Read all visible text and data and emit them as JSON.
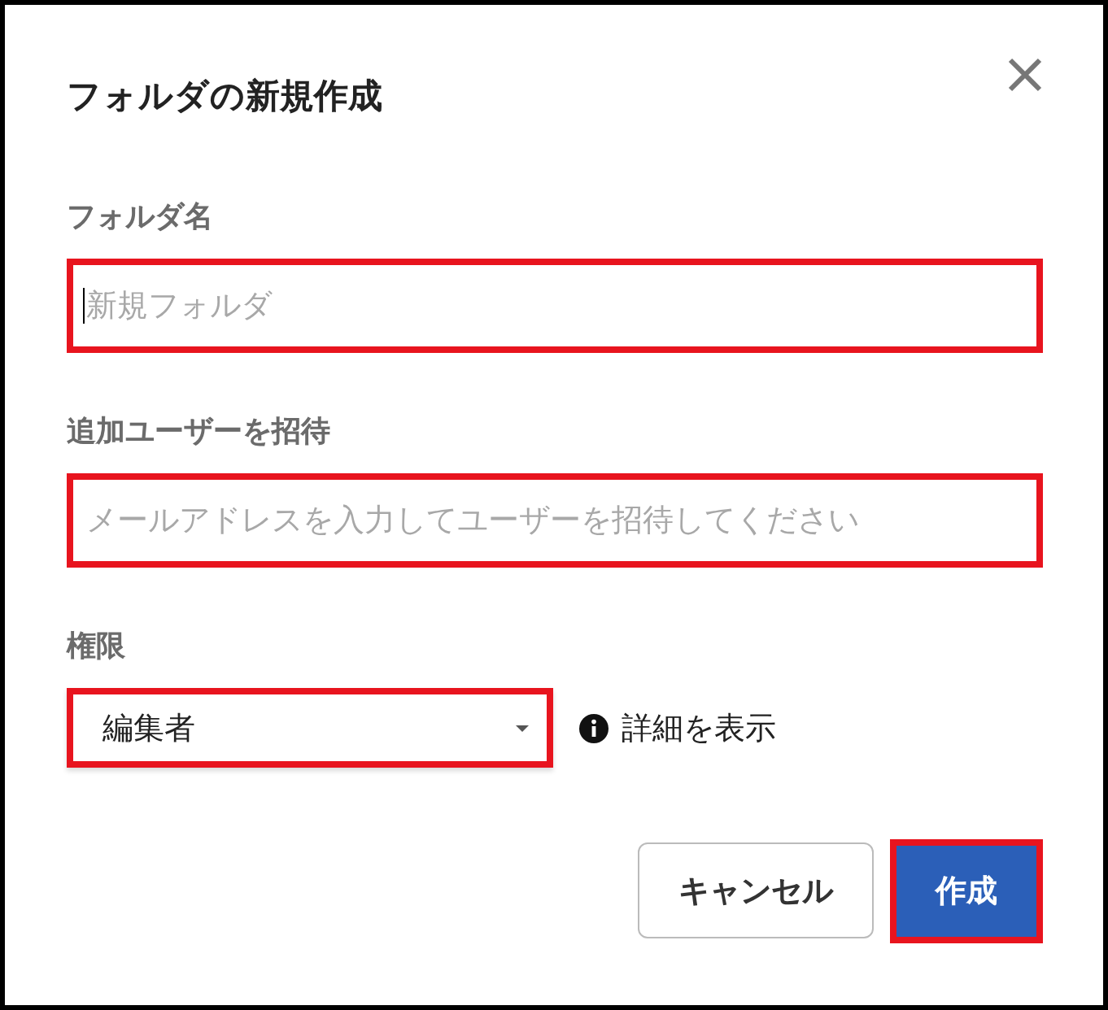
{
  "dialog": {
    "title": "フォルダの新規作成"
  },
  "fields": [
    {
      "kind": "text",
      "label": "フォルダ名",
      "placeholder": "新規フォルダ",
      "focused": true,
      "highlighted": true
    },
    {
      "kind": "text",
      "label": "追加ユーザーを招待",
      "placeholder": "メールアドレスを入力してユーザーを招待してください",
      "focused": false,
      "highlighted": true
    },
    {
      "kind": "select",
      "label": "権限",
      "value": "編集者",
      "highlighted": true,
      "info_link": "詳細を表示"
    }
  ],
  "buttons": [
    {
      "label": "キャンセル",
      "kind": "secondary",
      "highlighted": false
    },
    {
      "label": "作成",
      "kind": "primary",
      "highlighted": true
    }
  ]
}
